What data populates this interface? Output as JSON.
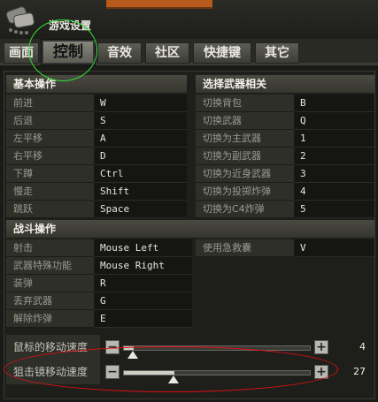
{
  "header": {
    "title": "游戏设置"
  },
  "tabs": [
    {
      "label": "画面",
      "active": false
    },
    {
      "label": "控制",
      "active": true
    },
    {
      "label": "音效",
      "active": false
    },
    {
      "label": "社区",
      "active": false
    },
    {
      "label": "快捷键",
      "active": false
    },
    {
      "label": "其它",
      "active": false
    }
  ],
  "basic": {
    "title": "基本操作",
    "rows": [
      {
        "label": "前进",
        "value": "W"
      },
      {
        "label": "后退",
        "value": "S"
      },
      {
        "label": "左平移",
        "value": "A"
      },
      {
        "label": "右平移",
        "value": "D"
      },
      {
        "label": "下蹲",
        "value": "Ctrl"
      },
      {
        "label": "慢走",
        "value": "Shift"
      },
      {
        "label": "跳跃",
        "value": "Space"
      }
    ]
  },
  "weapon": {
    "title": "选择武器相关",
    "rows": [
      {
        "label": "切换背包",
        "value": "B"
      },
      {
        "label": "切换武器",
        "value": "Q"
      },
      {
        "label": "切换为主武器",
        "value": "1"
      },
      {
        "label": "切换为副武器",
        "value": "2"
      },
      {
        "label": "切换为近身武器",
        "value": "3"
      },
      {
        "label": "切换为投掷炸弹",
        "value": "4"
      },
      {
        "label": "切换为C4炸弹",
        "value": "5"
      }
    ]
  },
  "combat": {
    "title": "战斗操作",
    "rows": [
      {
        "label": "射击",
        "value": "Mouse Left"
      },
      {
        "label": "武器特殊功能",
        "value": "Mouse Right"
      },
      {
        "label": "装弹",
        "value": "R"
      },
      {
        "label": "丢弃武器",
        "value": "G"
      },
      {
        "label": "解除炸弹",
        "value": "E"
      }
    ],
    "extra": {
      "label": "使用急救囊",
      "value": "V"
    }
  },
  "sliders": [
    {
      "label": "鼠标的移动速度",
      "value": "4",
      "fraction": 0.04
    },
    {
      "label": "狙击镜移动速度",
      "value": "27",
      "fraction": 0.27
    }
  ],
  "colors": {
    "annotation_green": "#30e030",
    "annotation_red": "#e01010",
    "header_orange": "#b85a1c"
  }
}
